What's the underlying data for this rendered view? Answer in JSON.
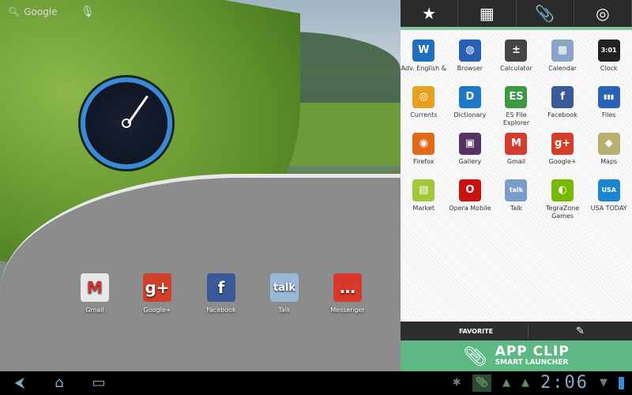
{
  "home": {
    "search_label": "Google",
    "dock": [
      {
        "label": "Gmail",
        "glyph": "M",
        "color": "#e8e8e8",
        "fg": "#c33"
      },
      {
        "label": "Google+",
        "glyph": "g+",
        "color": "#d2402a",
        "fg": "#fff"
      },
      {
        "label": "Facebook",
        "glyph": "f",
        "color": "#3b5998",
        "fg": "#fff"
      },
      {
        "label": "Talk",
        "glyph": "talk",
        "color": "#9bb8d8",
        "fg": "#fff"
      },
      {
        "label": "Messenger",
        "glyph": "…",
        "color": "#d8392b",
        "fg": "#fff"
      }
    ]
  },
  "panel": {
    "tabs": [
      "★",
      "▦",
      "📎",
      "◎"
    ],
    "apps": [
      {
        "label": "Adv. English &",
        "glyph": "W",
        "color": "#1e6fc0"
      },
      {
        "label": "Browser",
        "glyph": "◍",
        "color": "#2a5fb8"
      },
      {
        "label": "Calculator",
        "glyph": "±",
        "color": "#444"
      },
      {
        "label": "Calendar",
        "glyph": "▦",
        "color": "#8aa4c8"
      },
      {
        "label": "Clock",
        "glyph": "3:01",
        "color": "#222"
      },
      {
        "label": "Currents",
        "glyph": "◎",
        "color": "#e8a020"
      },
      {
        "label": "Dictionary",
        "glyph": "D",
        "color": "#1e78c8"
      },
      {
        "label": "ES File Explorer",
        "glyph": "ES",
        "color": "#3a9a40"
      },
      {
        "label": "Facebook",
        "glyph": "f",
        "color": "#3b5998"
      },
      {
        "label": "Files",
        "glyph": "▮▮▮",
        "color": "#2a62b8"
      },
      {
        "label": "Firefox",
        "glyph": "◉",
        "color": "#e06a18"
      },
      {
        "label": "Gallery",
        "glyph": "▣",
        "color": "#553366"
      },
      {
        "label": "Gmail",
        "glyph": "M",
        "color": "#d43c30"
      },
      {
        "label": "Google+",
        "glyph": "g+",
        "color": "#d2402a"
      },
      {
        "label": "Maps",
        "glyph": "◆",
        "color": "#b8b070"
      },
      {
        "label": "Market",
        "glyph": "▤",
        "color": "#a4c639"
      },
      {
        "label": "Opera Mobile",
        "glyph": "O",
        "color": "#cc1010"
      },
      {
        "label": "Talk",
        "glyph": "talk",
        "color": "#7a9cc8"
      },
      {
        "label": "TegraZone Games",
        "glyph": "◐",
        "color": "#76b900"
      },
      {
        "label": "USA TODAY",
        "glyph": "USA",
        "color": "#1a86d0"
      }
    ],
    "favorite_label": "FAVORITE",
    "edit_icon": "✎",
    "brand_title": "APP CLIP",
    "brand_subtitle": "SMART LAUNCHER"
  },
  "statusbar": {
    "time": "2:06"
  }
}
